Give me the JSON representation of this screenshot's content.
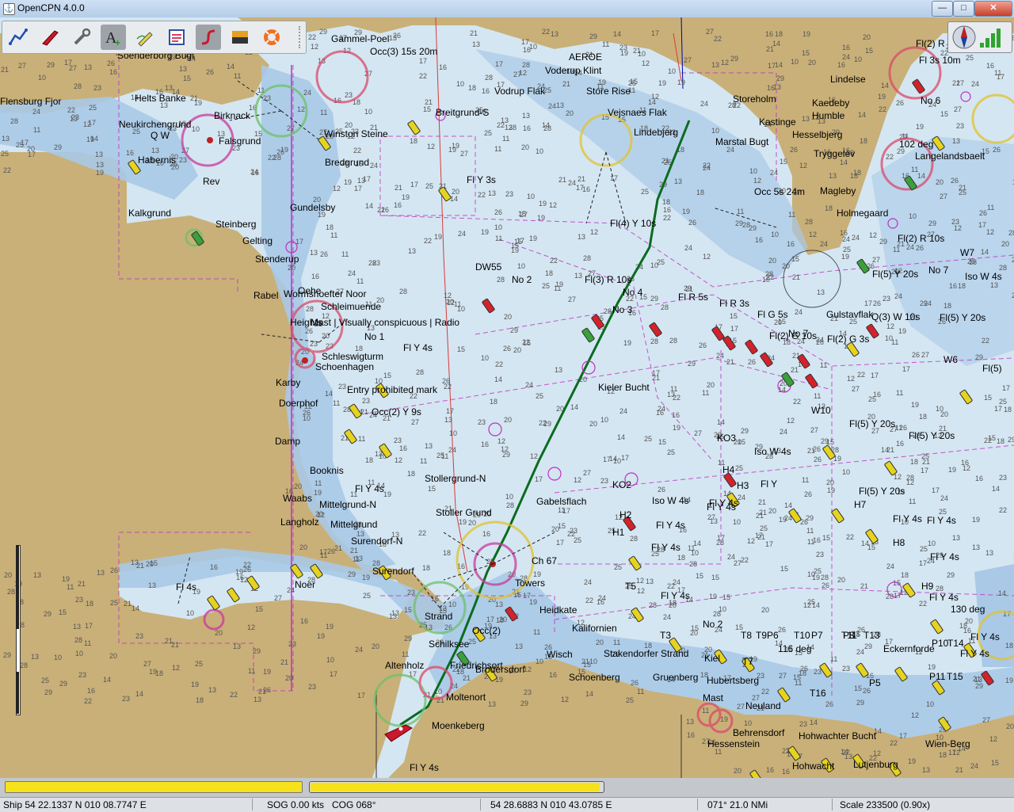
{
  "window": {
    "title": "OpenCPN 4.0.0",
    "minimize": "—",
    "maximize": "□",
    "close": "✕"
  },
  "toolbar": {
    "buttons": [
      {
        "name": "route-icon",
        "active": false
      },
      {
        "name": "ship-icon",
        "active": false
      },
      {
        "name": "settings-wrench-icon",
        "active": false
      },
      {
        "name": "text-add-icon",
        "active": true
      },
      {
        "name": "pencil-track-icon",
        "active": false
      },
      {
        "name": "checklist-icon",
        "active": false
      },
      {
        "name": "route-manager-icon",
        "active": true
      },
      {
        "name": "color-scheme-icon",
        "active": false
      },
      {
        "name": "man-overboard-icon",
        "active": false
      }
    ]
  },
  "chart": {
    "land_color": "#c9b078",
    "shallow_color": "#a9c9e7",
    "deep_color": "#d4e6f2",
    "route_color": "#0b6b1f",
    "labels": [
      "Gammel-Poel",
      "Occ(3) 15s 20m",
      "AEROE",
      "Voderup Klint",
      "Vodrup Flak",
      "Store Rise",
      "Storeholm",
      "Lindelse",
      "Kaedeby",
      "Humble",
      "Hesselbjerg",
      "Tryggelev",
      "Magleby",
      "Holmegaard",
      "Marstal Bugt",
      "Kastinge",
      "Soenderborg Bugt",
      "Helts Banke",
      "Flensburg Fjor",
      "Neukirchengrund",
      "Q W",
      "Habernis",
      "Falsgrund",
      "Birknack",
      "Kalkgrund",
      "Steinberg",
      "Gelting",
      "Stenderup",
      "Gundelsby",
      "Winston Steine",
      "Bredgrund",
      "Breitgrund-S",
      "Fl Y 3s",
      "Fl(4) Y 10s",
      "Vejsnaes Flak",
      "Lindebjerg",
      "Occ 5s 24m",
      "102 deg",
      "Langelandsbaelt",
      "Fl 3s 10m",
      "Fl(2) R 10s",
      "Fl(2) R 5s",
      "DW55",
      "No 2",
      "Fl(3) R 10s",
      "No 4",
      "Fl R 5s",
      "Fl R 3s",
      "No 3",
      "Fl G 5s",
      "Fl(2) G 10s",
      "No 7",
      "Fl(2) G 3s",
      "Fl(5) Y 20s",
      "Q(3) W 10s",
      "Fl(5) Y 20s",
      "Gulstavflak",
      "No 6",
      "No 7",
      "W7",
      "Iso W 4s",
      "Rabel",
      "Oehe",
      "Wormshoefter Noor",
      "Schleimuende",
      "Heights",
      "Mast | Visually conspicuous | Radio",
      "No 1",
      "Fl Y 4s",
      "Schleswigturm",
      "Schoenhagen",
      "Entry prohibited mark",
      "Occ(2) Y 9s",
      "Karby",
      "Doerphof",
      "Damp",
      "Kieler Bucht",
      "Iso W 4s",
      "KO3",
      "W10",
      "W6",
      "Fl(5) Y 20s",
      "Fl(5) Y 20s",
      "Fl(5)",
      "Booknis",
      "Stollergrund-N",
      "Gabelsflach",
      "Fl Y 4s",
      "Stoller Grund",
      "Waabs",
      "Mittelgrund-N",
      "Langholz",
      "Mittelgrund",
      "Surendorf-N",
      "Surendorf",
      "Noer",
      "Fl Y 4s",
      "Iso W 4s",
      "KO2",
      "H4",
      "H3",
      "Fl Y",
      "Fl Y 4s",
      "H2",
      "H1",
      "Fl Y 4s",
      "Fl Y 4s",
      "Fl(5) Y 20s",
      "Fl Y 4s",
      "Fl Y 4s",
      "H7",
      "H8",
      "H9",
      "Fl Y 4s",
      "Fl Y 4s",
      "Strand",
      "Ch 67",
      "Towers",
      "Heidkate",
      "Kalifornien",
      "Schilksee",
      "Occ(2)",
      "Friedrichsort",
      "Wisch",
      "Stakendorfer Strand",
      "Schoenberg",
      "Gruenberg",
      "Hubertsberg",
      "Brodersdorf",
      "Altenholz",
      "Moltenort",
      "Moenkeberg",
      "Mast",
      "Neuland",
      "Behrensdorf",
      "Hessenstein",
      "Hohwachter Bucht",
      "Hohwacht",
      "Lutjenburg",
      "Wien-Berg",
      "T5",
      "T3",
      "T8",
      "T9",
      "P6",
      "T10",
      "P7",
      "T11",
      "P8",
      "T13",
      "P10",
      "T14",
      "P11",
      "T15",
      "T16",
      "P5",
      "T7",
      "No 2",
      "Fl Y 4s",
      "Fl Y 4s",
      "Fl Y 4s",
      "Kiel",
      "Eckernforde",
      "Fl Y 4s",
      "Fl 4s",
      "130 deg",
      "116 deg",
      "Rev"
    ]
  },
  "status": {
    "ship": "Ship 54 22.1337 N   010 08.7747 E",
    "sog": "SOG 0.00 kts",
    "cog": "COG 068°",
    "cursor": "54 28.6883 N   010 43.0785 E",
    "bearing": "071°  21.0 NMi",
    "scale": "Scale 233500 (0.90x)"
  },
  "progress": {
    "chart_bar_fraction": 1.0,
    "slider_fraction": 0.99
  }
}
